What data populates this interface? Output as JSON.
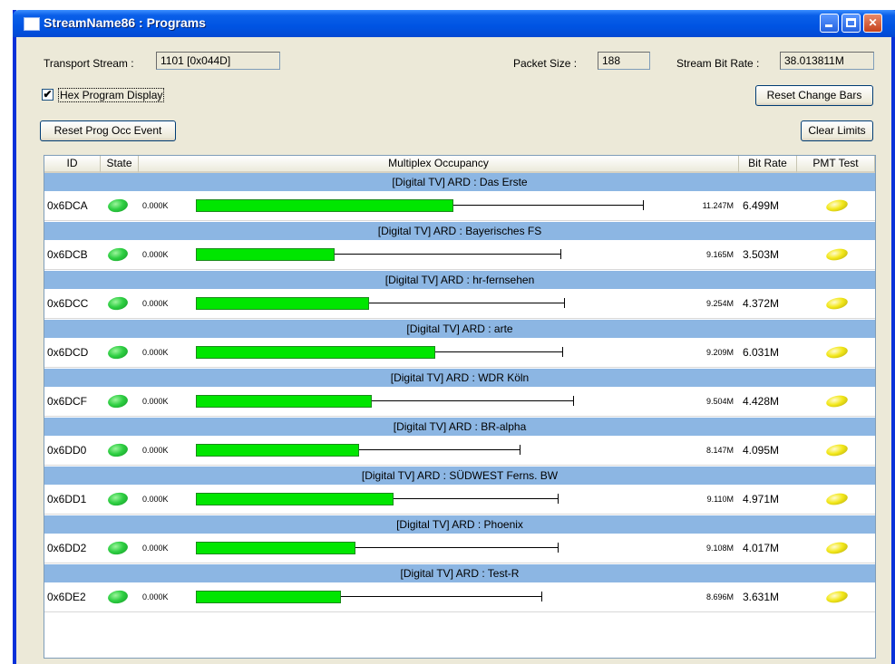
{
  "window": {
    "title": "StreamName86 : Programs"
  },
  "info": {
    "transport_stream_label": "Transport Stream :",
    "transport_stream_value": "1101 [0x044D]",
    "packet_size_label": "Packet Size :",
    "packet_size_value": "188",
    "bit_rate_label": "Stream Bit Rate :",
    "bit_rate_value": "38.013811M"
  },
  "controls": {
    "hex_display_label": "Hex Program Display",
    "hex_display_checked": true,
    "reset_change_bars": "Reset Change Bars",
    "reset_prog_occ": "Reset Prog Occ Event",
    "clear_limits": "Clear Limits"
  },
  "columns": {
    "id": "ID",
    "state": "State",
    "occupancy": "Multiplex Occupancy",
    "bit_rate": "Bit Rate",
    "pmt_test": "PMT Test"
  },
  "colors": {
    "group_bg": "#8cb6e3",
    "bar_fill": "#00e600",
    "state_ok": "#2fcf43",
    "pmt_ok": "#f3e81b"
  },
  "programs": [
    {
      "group": "[Digital TV] ARD : Das Erste",
      "id": "0x6DCA",
      "occ": "0.000K",
      "fill": 0.574,
      "peak_pos": 1.0,
      "peak": "11.247M",
      "rate": "6.499M"
    },
    {
      "group": "[Digital TV] ARD : Bayerisches FS",
      "id": "0x6DCB",
      "occ": "0.000K",
      "fill": 0.309,
      "peak_pos": 0.815,
      "peak": "9.165M",
      "rate": "3.503M"
    },
    {
      "group": "[Digital TV] ARD : hr-fernsehen",
      "id": "0x6DCC",
      "occ": "0.000K",
      "fill": 0.386,
      "peak_pos": 0.823,
      "peak": "9.254M",
      "rate": "4.372M"
    },
    {
      "group": "[Digital TV] ARD : arte",
      "id": "0x6DCD",
      "occ": "0.000K",
      "fill": 0.534,
      "peak_pos": 0.819,
      "peak": "9.209M",
      "rate": "6.031M"
    },
    {
      "group": "[Digital TV] ARD : WDR Köln",
      "id": "0x6DCF",
      "occ": "0.000K",
      "fill": 0.392,
      "peak_pos": 0.845,
      "peak": "9.504M",
      "rate": "4.428M"
    },
    {
      "group": "[Digital TV] ARD : BR-alpha",
      "id": "0x6DD0",
      "occ": "0.000K",
      "fill": 0.364,
      "peak_pos": 0.724,
      "peak": "8.147M",
      "rate": "4.095M"
    },
    {
      "group": "[Digital TV] ARD : SÜDWEST Ferns. BW",
      "id": "0x6DD1",
      "occ": "0.000K",
      "fill": 0.442,
      "peak_pos": 0.81,
      "peak": "9.110M",
      "rate": "4.971M"
    },
    {
      "group": "[Digital TV] ARD : Phoenix",
      "id": "0x6DD2",
      "occ": "0.000K",
      "fill": 0.357,
      "peak_pos": 0.81,
      "peak": "9.108M",
      "rate": "4.017M"
    },
    {
      "group": "[Digital TV] ARD : Test-R",
      "id": "0x6DE2",
      "occ": "0.000K",
      "fill": 0.323,
      "peak_pos": 0.773,
      "peak": "8.696M",
      "rate": "3.631M"
    }
  ]
}
